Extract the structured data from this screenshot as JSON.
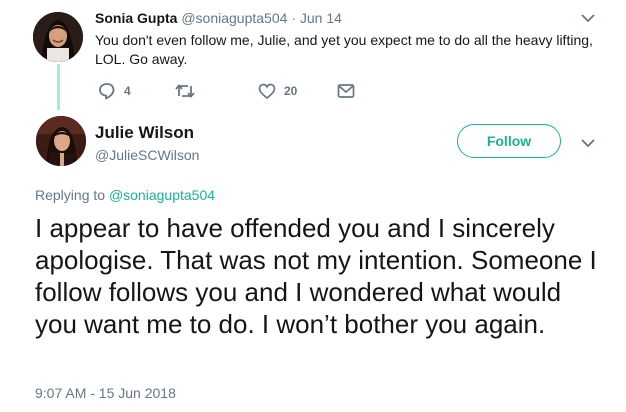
{
  "reply": {
    "author_name": "Sonia Gupta",
    "author_handle": "@soniagupta504",
    "separator": "·",
    "date": "Jun 14",
    "text": "You don't even follow me, Julie, and yet you expect me to do all the heavy lifting, LOL. Go away.",
    "replies_count": "4",
    "retweets_count": "",
    "likes_count": "20"
  },
  "main_tweet": {
    "author_name": "Julie Wilson",
    "author_handle": "@JulieSCWilson",
    "follow_label": "Follow",
    "replying_prefix": "Replying to ",
    "replying_to": "@soniagupta504",
    "text": "I appear to have offended you and I sincerely apologise. That was not my intention. Someone I follow follows you and I wondered what would you want me to do. I won’t bother you again.",
    "timestamp": "9:07 AM - 15 Jun 2018"
  },
  "colors": {
    "accent": "#1ab394",
    "secondary_text": "#657786",
    "thread_line": "#a8e6d8"
  },
  "icons": [
    "chevron-down-icon",
    "reply-icon",
    "retweet-icon",
    "heart-icon",
    "direct-message-icon"
  ]
}
